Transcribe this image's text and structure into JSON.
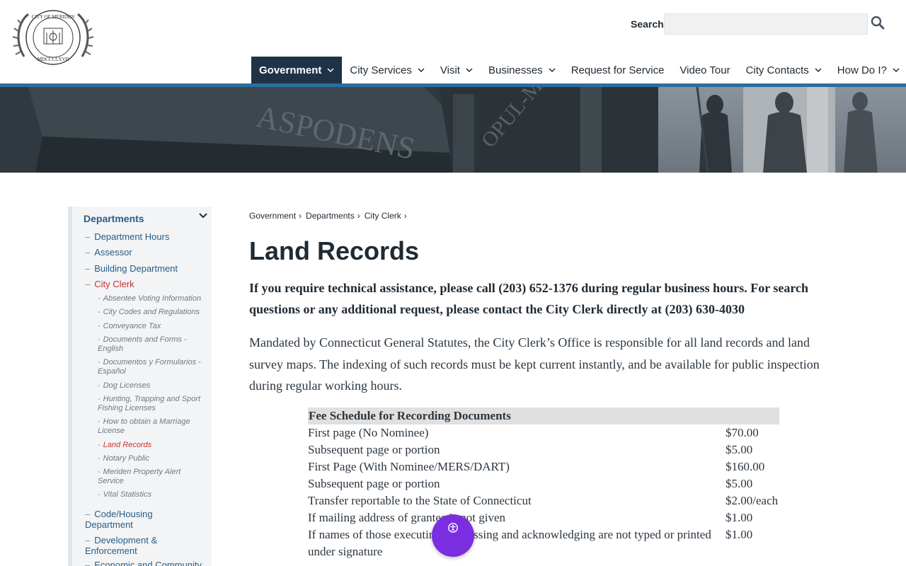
{
  "header": {
    "logo_alt": "City of Meriden seal",
    "logo_text_top": "CITY OF MERIDEN",
    "logo_text_bottom": "MDCCCLXVII",
    "search_label": "Search",
    "search_placeholder": "",
    "nav": [
      {
        "label": "Government",
        "dropdown": true,
        "active": true
      },
      {
        "label": "City Services",
        "dropdown": true
      },
      {
        "label": "Visit",
        "dropdown": true
      },
      {
        "label": "Businesses",
        "dropdown": true
      },
      {
        "label": "Request for Service",
        "dropdown": false
      },
      {
        "label": "Video Tour",
        "dropdown": false
      },
      {
        "label": "City Contacts",
        "dropdown": true
      },
      {
        "label": "How Do I?",
        "dropdown": true
      }
    ]
  },
  "sidebar": {
    "heading": "Departments",
    "items": [
      {
        "label": "Department Hours"
      },
      {
        "label": "Assessor"
      },
      {
        "label": "Building Department"
      },
      {
        "label": "City Clerk"
      },
      {
        "label": "Code/Housing Department"
      },
      {
        "label": "Development & Enforcement"
      },
      {
        "label": "Economic and Community"
      }
    ],
    "sub_items": [
      {
        "label": "Absentee Voting Information"
      },
      {
        "label": "City Codes and Regulations"
      },
      {
        "label": "Conveyance Tax"
      },
      {
        "label": "Documents and Forms - English"
      },
      {
        "label": "Documentos y Formularios - Español"
      },
      {
        "label": "Dog Licenses"
      },
      {
        "label": "Hunting, Trapping and Sport Fishing Licenses"
      },
      {
        "label": "How to obtain a Marriage License"
      },
      {
        "label": "Land Records"
      },
      {
        "label": "Notary Public"
      },
      {
        "label": "Meriden Property Alert Service"
      },
      {
        "label": "Vital Statistics"
      }
    ]
  },
  "breadcrumb": [
    "Government",
    "Departments",
    "City Clerk"
  ],
  "breadcrumb_sep": "›",
  "main": {
    "title": "Land Records",
    "lead": "If you require technical assistance, please call (203) 652-1376 during regular business hours. For search questions or any additional request, please contact the City Clerk directly at (203) 630-4030",
    "body": "Mandated by Connecticut General Statutes, the City Clerk’s Office is responsible for all land records and land survey maps.  The indexing of such records must be kept current instantly, and be available for public inspection during regular working hours.",
    "fee_table": {
      "header": "Fee Schedule for Recording Documents",
      "rows": [
        {
          "item": "First page (No Nominee)",
          "fee": "$70.00"
        },
        {
          "item": "Subsequent page or portion",
          "fee": "$5.00"
        },
        {
          "item": "First Page (With Nominee/MERS/DART)",
          "fee": "$160.00"
        },
        {
          "item": "Subsequent page or portion",
          "fee": "$5.00"
        },
        {
          "item": "Transfer reportable to the State of Connecticut",
          "fee": "$2.00/each"
        },
        {
          "item": "If mailing address of grantee is not given",
          "fee": "$1.00"
        },
        {
          "item": "If names of those executing, witnessing and acknowledging are not typed or printed under signature",
          "fee": "$1.00"
        }
      ]
    }
  },
  "accessibility_button": {
    "icon": "accessibility-icon",
    "color": "#7b2ee0"
  },
  "colors": {
    "nav_active_bg": "#1f3347",
    "accent_blue": "#2e6d9e",
    "link_blue": "#2a5d85",
    "current_red": "#c8332c"
  }
}
